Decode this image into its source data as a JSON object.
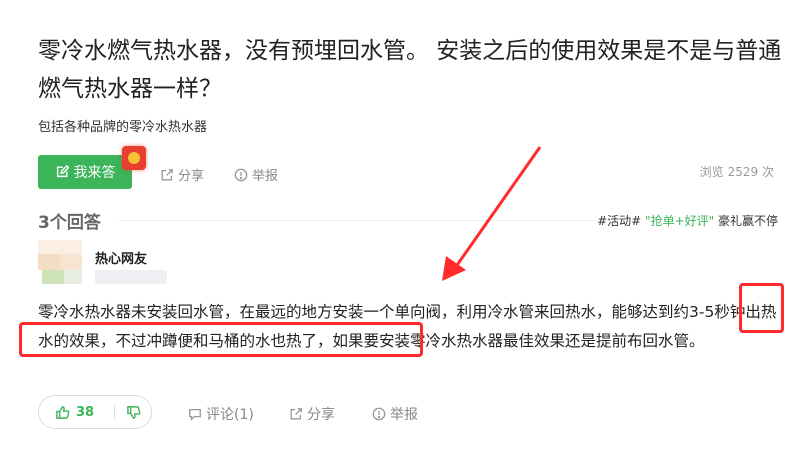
{
  "question": {
    "title": "零冷水燃气热水器，没有预埋回水管。 安装之后的使用效果是不是与普通燃气热水器一样？",
    "description": "包括各种品牌的零冷水热水器",
    "answer_button": "我来答",
    "share": "分享",
    "report": "举报",
    "views_label": "浏览",
    "views_count": "2529 次"
  },
  "answers_header": {
    "count": "3个回答",
    "promo_tag": "#活动#",
    "promo_highlight": "\"抢单+好评\"",
    "promo_tail": "豪礼赢不停"
  },
  "answer": {
    "username": "热心网友",
    "text": "零冷水热水器未安装回水管，在最远的地方安装一个单向阀，利用冷水管来回热水，能够达到约3-5秒钟出热水的效果，不过冲蹲便和马桶的水也热了，如果要安装零冷水热水器最佳效果还是提前布回水管。",
    "likes": "38",
    "comment": "评论(1)",
    "share": "分享",
    "report": "举报"
  },
  "colors": {
    "brand_green": "#3cb45a",
    "annotation_red": "#ff2a2a"
  }
}
